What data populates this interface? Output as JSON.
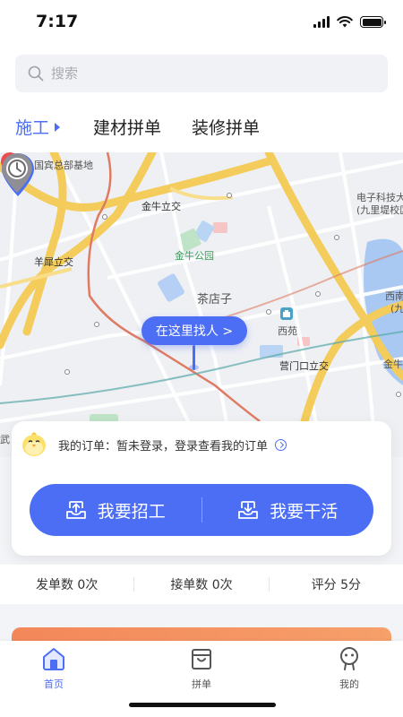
{
  "status_bar": {
    "time": "7:17",
    "battery_level": 1.0
  },
  "search": {
    "placeholder": "搜索",
    "value": ""
  },
  "tabs": [
    {
      "label": "施工",
      "active": true
    },
    {
      "label": "建材拼单",
      "active": false
    },
    {
      "label": "装修拼单",
      "active": false
    }
  ],
  "map": {
    "labels": {
      "guobin": "国宾总部基地",
      "jinniu_lijiao": "金牛立交",
      "yangxi_lijiao": "羊犀立交",
      "jinniu_park": "金牛公园",
      "chadianzi": "茶店子",
      "xiyuan": "西苑",
      "yingmenkou_lijiao": "营门口立交",
      "dianzi_keji": "电子科技大",
      "jiulidi": "(九里堤校区",
      "xinan": "西南",
      "xinan_2": "(九",
      "jinniu_edge": "金牛",
      "wu_edge": "武"
    },
    "find_button": "在这里找人 >"
  },
  "order_card": {
    "order_text": "我的订单：暂未登录，登录查看我的订单",
    "recruit_label": "我要招工",
    "work_label": "我要干活"
  },
  "stats": [
    {
      "label": "发单数 0次"
    },
    {
      "label": "接单数 0次"
    },
    {
      "label": "评分 5分"
    }
  ],
  "bottom_nav": [
    {
      "label": "首页",
      "icon": "home-icon",
      "active": true
    },
    {
      "label": "拼单",
      "icon": "bag-icon",
      "active": false
    },
    {
      "label": "我的",
      "icon": "profile-icon",
      "active": false
    }
  ],
  "colors": {
    "accent": "#4b6ef5",
    "map_road": "#f3cc5c",
    "map_rail": "#e07b63"
  }
}
